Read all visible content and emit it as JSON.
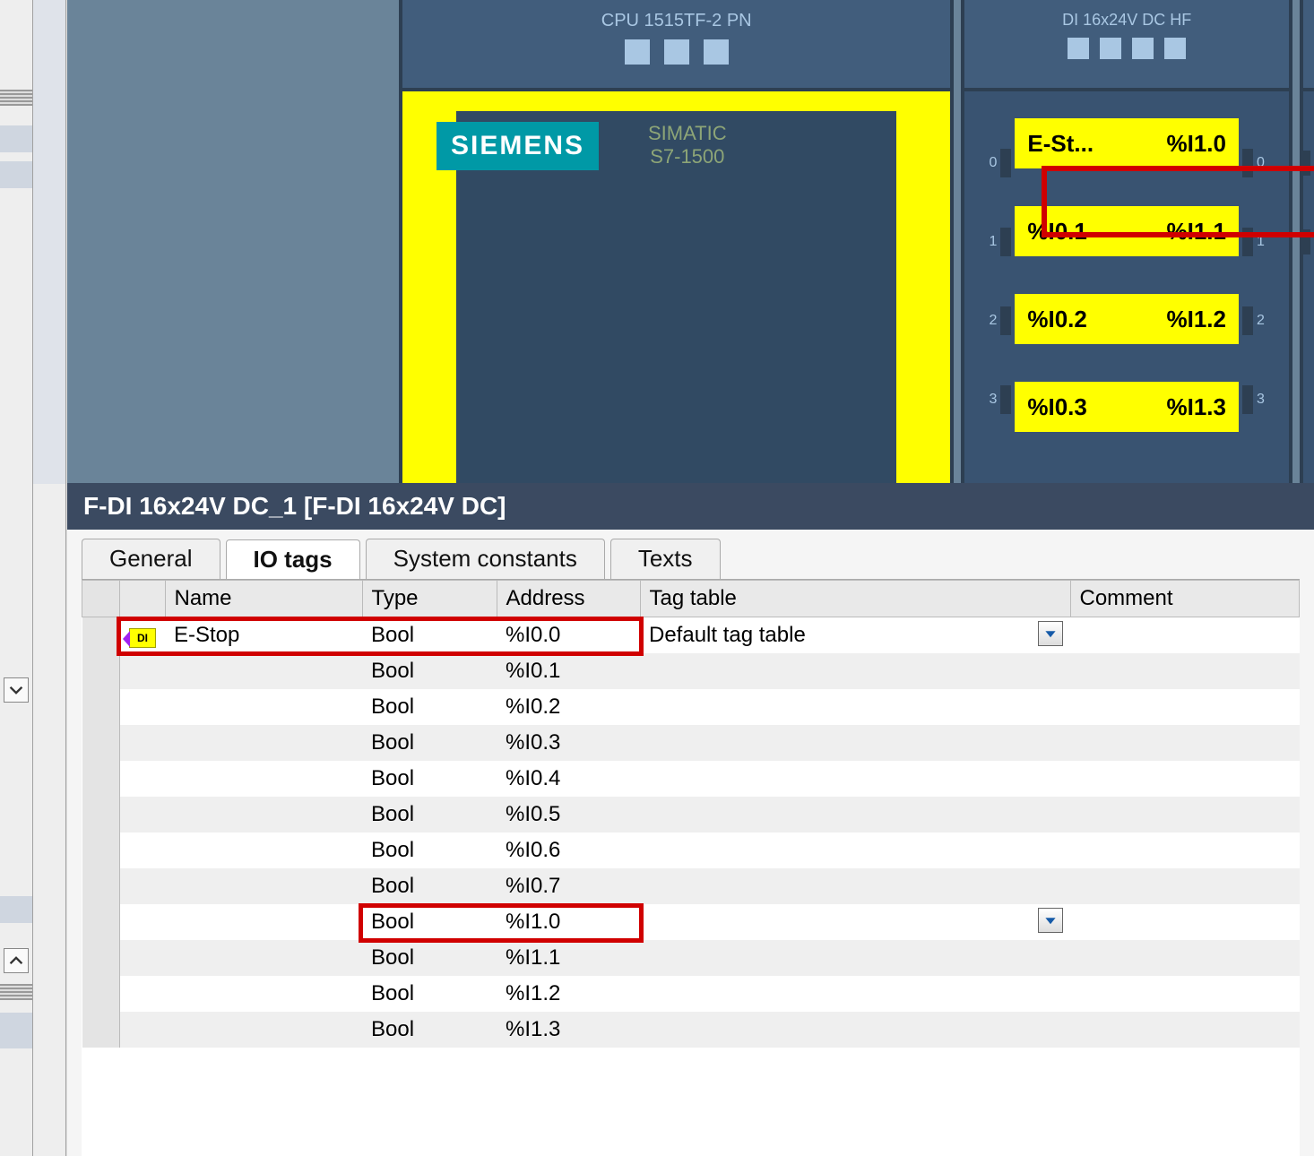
{
  "hardware": {
    "cpu": {
      "title": "CPU 1515TF-2 PN",
      "brand": "SIEMENS",
      "family_line1": "SIMATIC",
      "family_line2": "S7-1500"
    },
    "di_module": {
      "title": "DI 16x24V DC HF",
      "channels": [
        {
          "left": "E-St...",
          "right": "%I1.0",
          "highlight": true
        },
        {
          "left": "%I0.1",
          "right": "%I1.1",
          "highlight": false
        },
        {
          "left": "%I0.2",
          "right": "%I1.2",
          "highlight": false
        },
        {
          "left": "%I0.3",
          "right": "%I1.3",
          "highlight": false
        }
      ],
      "port_numbers_left": [
        "0",
        "1",
        "2",
        "3"
      ],
      "port_numbers_right": [
        "0",
        "1",
        "2",
        "3"
      ]
    }
  },
  "props": {
    "title": "F-DI 16x24V DC_1 [F-DI 16x24V DC]",
    "tabs": {
      "general": "General",
      "iotags": "IO tags",
      "sysconst": "System constants",
      "texts": "Texts"
    },
    "columns": {
      "name": "Name",
      "type": "Type",
      "address": "Address",
      "tagtable": "Tag table",
      "comment": "Comment"
    },
    "rows": [
      {
        "name": "E-Stop",
        "type": "Bool",
        "address": "%I0.0",
        "tagtable": "Default tag table",
        "hasIcon": true,
        "redRow": true,
        "selectedTag": true
      },
      {
        "name": "",
        "type": "Bool",
        "address": "%I0.1",
        "tagtable": ""
      },
      {
        "name": "",
        "type": "Bool",
        "address": "%I0.2",
        "tagtable": ""
      },
      {
        "name": "",
        "type": "Bool",
        "address": "%I0.3",
        "tagtable": ""
      },
      {
        "name": "",
        "type": "Bool",
        "address": "%I0.4",
        "tagtable": ""
      },
      {
        "name": "",
        "type": "Bool",
        "address": "%I0.5",
        "tagtable": ""
      },
      {
        "name": "",
        "type": "Bool",
        "address": "%I0.6",
        "tagtable": ""
      },
      {
        "name": "",
        "type": "Bool",
        "address": "%I0.7",
        "tagtable": ""
      },
      {
        "name": "",
        "type": "Bool",
        "address": "%I1.0",
        "tagtable": "",
        "redTypeAddr": true,
        "selectedTag": true
      },
      {
        "name": "",
        "type": "Bool",
        "address": "%I1.1",
        "tagtable": ""
      },
      {
        "name": "",
        "type": "Bool",
        "address": "%I1.2",
        "tagtable": ""
      },
      {
        "name": "",
        "type": "Bool",
        "address": "%I1.3",
        "tagtable": ""
      }
    ]
  }
}
